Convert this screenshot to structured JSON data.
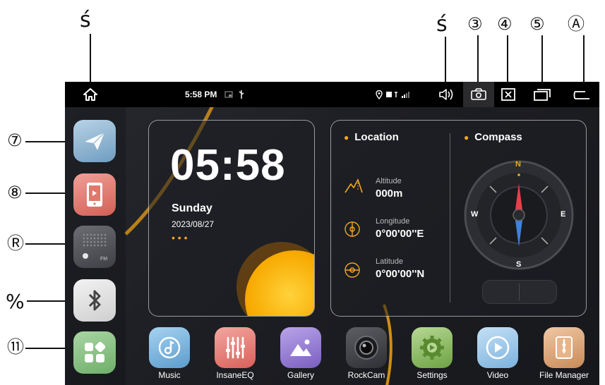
{
  "callouts": {
    "c1": "ś",
    "c2": "ś",
    "c3": "③",
    "c4": "④",
    "c5": "⑤",
    "c6": "Ⓐ",
    "c7": "⑦",
    "c8": "⑧",
    "c9": "Ⓡ",
    "c10": "%",
    "c11": "⑪"
  },
  "statusbar": {
    "time": "5:58 PM",
    "icons": [
      "home-icon",
      "notification-icon",
      "usb-icon",
      "location-pin-icon",
      "signal-icon",
      "volume-icon",
      "screenshot-icon",
      "close-window-icon",
      "recent-apps-icon",
      "back-icon"
    ]
  },
  "clock": {
    "time": "05:58",
    "day": "Sunday",
    "date": "2023/08/27",
    "dots": "• • •"
  },
  "location": {
    "title": "Location",
    "altitude_label": "Altitude",
    "altitude_value": "000m",
    "longitude_label": "Longitude",
    "longitude_value": "0°00'00''E",
    "latitude_label": "Latitude",
    "latitude_value": "0°00'00''N"
  },
  "compass": {
    "title": "Compass",
    "n": "N",
    "e": "E",
    "s": "S",
    "w": "W"
  },
  "left_dock": [
    {
      "name": "navigation",
      "icon": "paper-plane-icon",
      "color": "#8fb3cf"
    },
    {
      "name": "phone-link",
      "icon": "phone-link-icon",
      "color": "#e0786c"
    },
    {
      "name": "radio",
      "icon": "radio-icon",
      "color": "#5b5d63",
      "label": "FM"
    },
    {
      "name": "bluetooth",
      "icon": "bluetooth-icon",
      "color": "#e6e6e6"
    },
    {
      "name": "all-apps",
      "icon": "apps-grid-icon",
      "color": "#8fc48a"
    }
  ],
  "bottom_apps": [
    {
      "label": "Music",
      "icon": "music-icon",
      "color": "#7fb7e0"
    },
    {
      "label": "InsaneEQ",
      "icon": "equalizer-icon",
      "color": "#e87f7a"
    },
    {
      "label": "Gallery",
      "icon": "gallery-icon",
      "color": "#9b7fd6"
    },
    {
      "label": "RockCam",
      "icon": "camera-icon",
      "color": "#4a4c52"
    },
    {
      "label": "Settings",
      "icon": "settings-icon",
      "color": "#8fc06a"
    },
    {
      "label": "Video",
      "icon": "video-icon",
      "color": "#9ac4e8"
    },
    {
      "label": "File Manager",
      "icon": "file-manager-icon",
      "color": "#d9a57a"
    }
  ]
}
